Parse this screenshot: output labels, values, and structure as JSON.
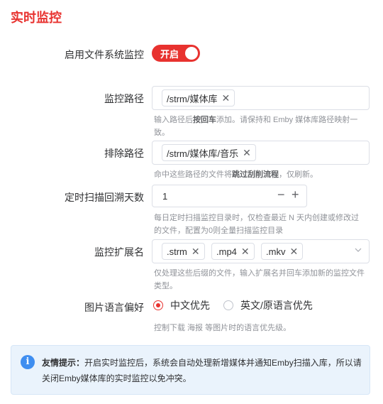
{
  "title": "实时监控",
  "fs_monitor": {
    "label": "启用文件系统监控",
    "switch_text": "开启"
  },
  "monitor_paths": {
    "label": "监控路径",
    "tags": [
      "/strm/媒体库"
    ],
    "help_pre": "输入路径后",
    "help_bold": "按回车",
    "help_post": "添加。请保持和 Emby 媒体库路径映射一致。"
  },
  "exclude_paths": {
    "label": "排除路径",
    "tags": [
      "/strm/媒体库/音乐"
    ],
    "help_pre": "命中这些路径的文件将",
    "help_bold": "跳过刮削流程",
    "help_post": "，仅刷新。"
  },
  "scan_days": {
    "label": "定时扫描回溯天数",
    "value": "1",
    "help": "每日定时扫描监控目录时，仅检查最近 N 天内创建或修改过的文件，配置为0则全量扫描监控目录"
  },
  "extensions": {
    "label": "监控扩展名",
    "tags": [
      ".strm",
      ".mp4",
      ".mkv"
    ],
    "help": "仅处理这些后缀的文件，输入扩展名并回车添加新的监控文件类型。"
  },
  "image_lang": {
    "label": "图片语言偏好",
    "options": [
      "中文优先",
      "英文/原语言优先"
    ],
    "selected": "中文优先",
    "help": "控制下载 海报 等图片时的语言优先级。"
  },
  "alert": {
    "icon": "info-icon",
    "title": "友情提示：",
    "text": "开启实时监控后，系统会自动处理新增媒体并通知Emby扫描入库，所以请关闭Emby媒体库的实时监控以免冲突。"
  },
  "colors": {
    "accent": "#e8322f",
    "info": "#3f8ef0",
    "alert_bg": "#eaf3fc"
  }
}
